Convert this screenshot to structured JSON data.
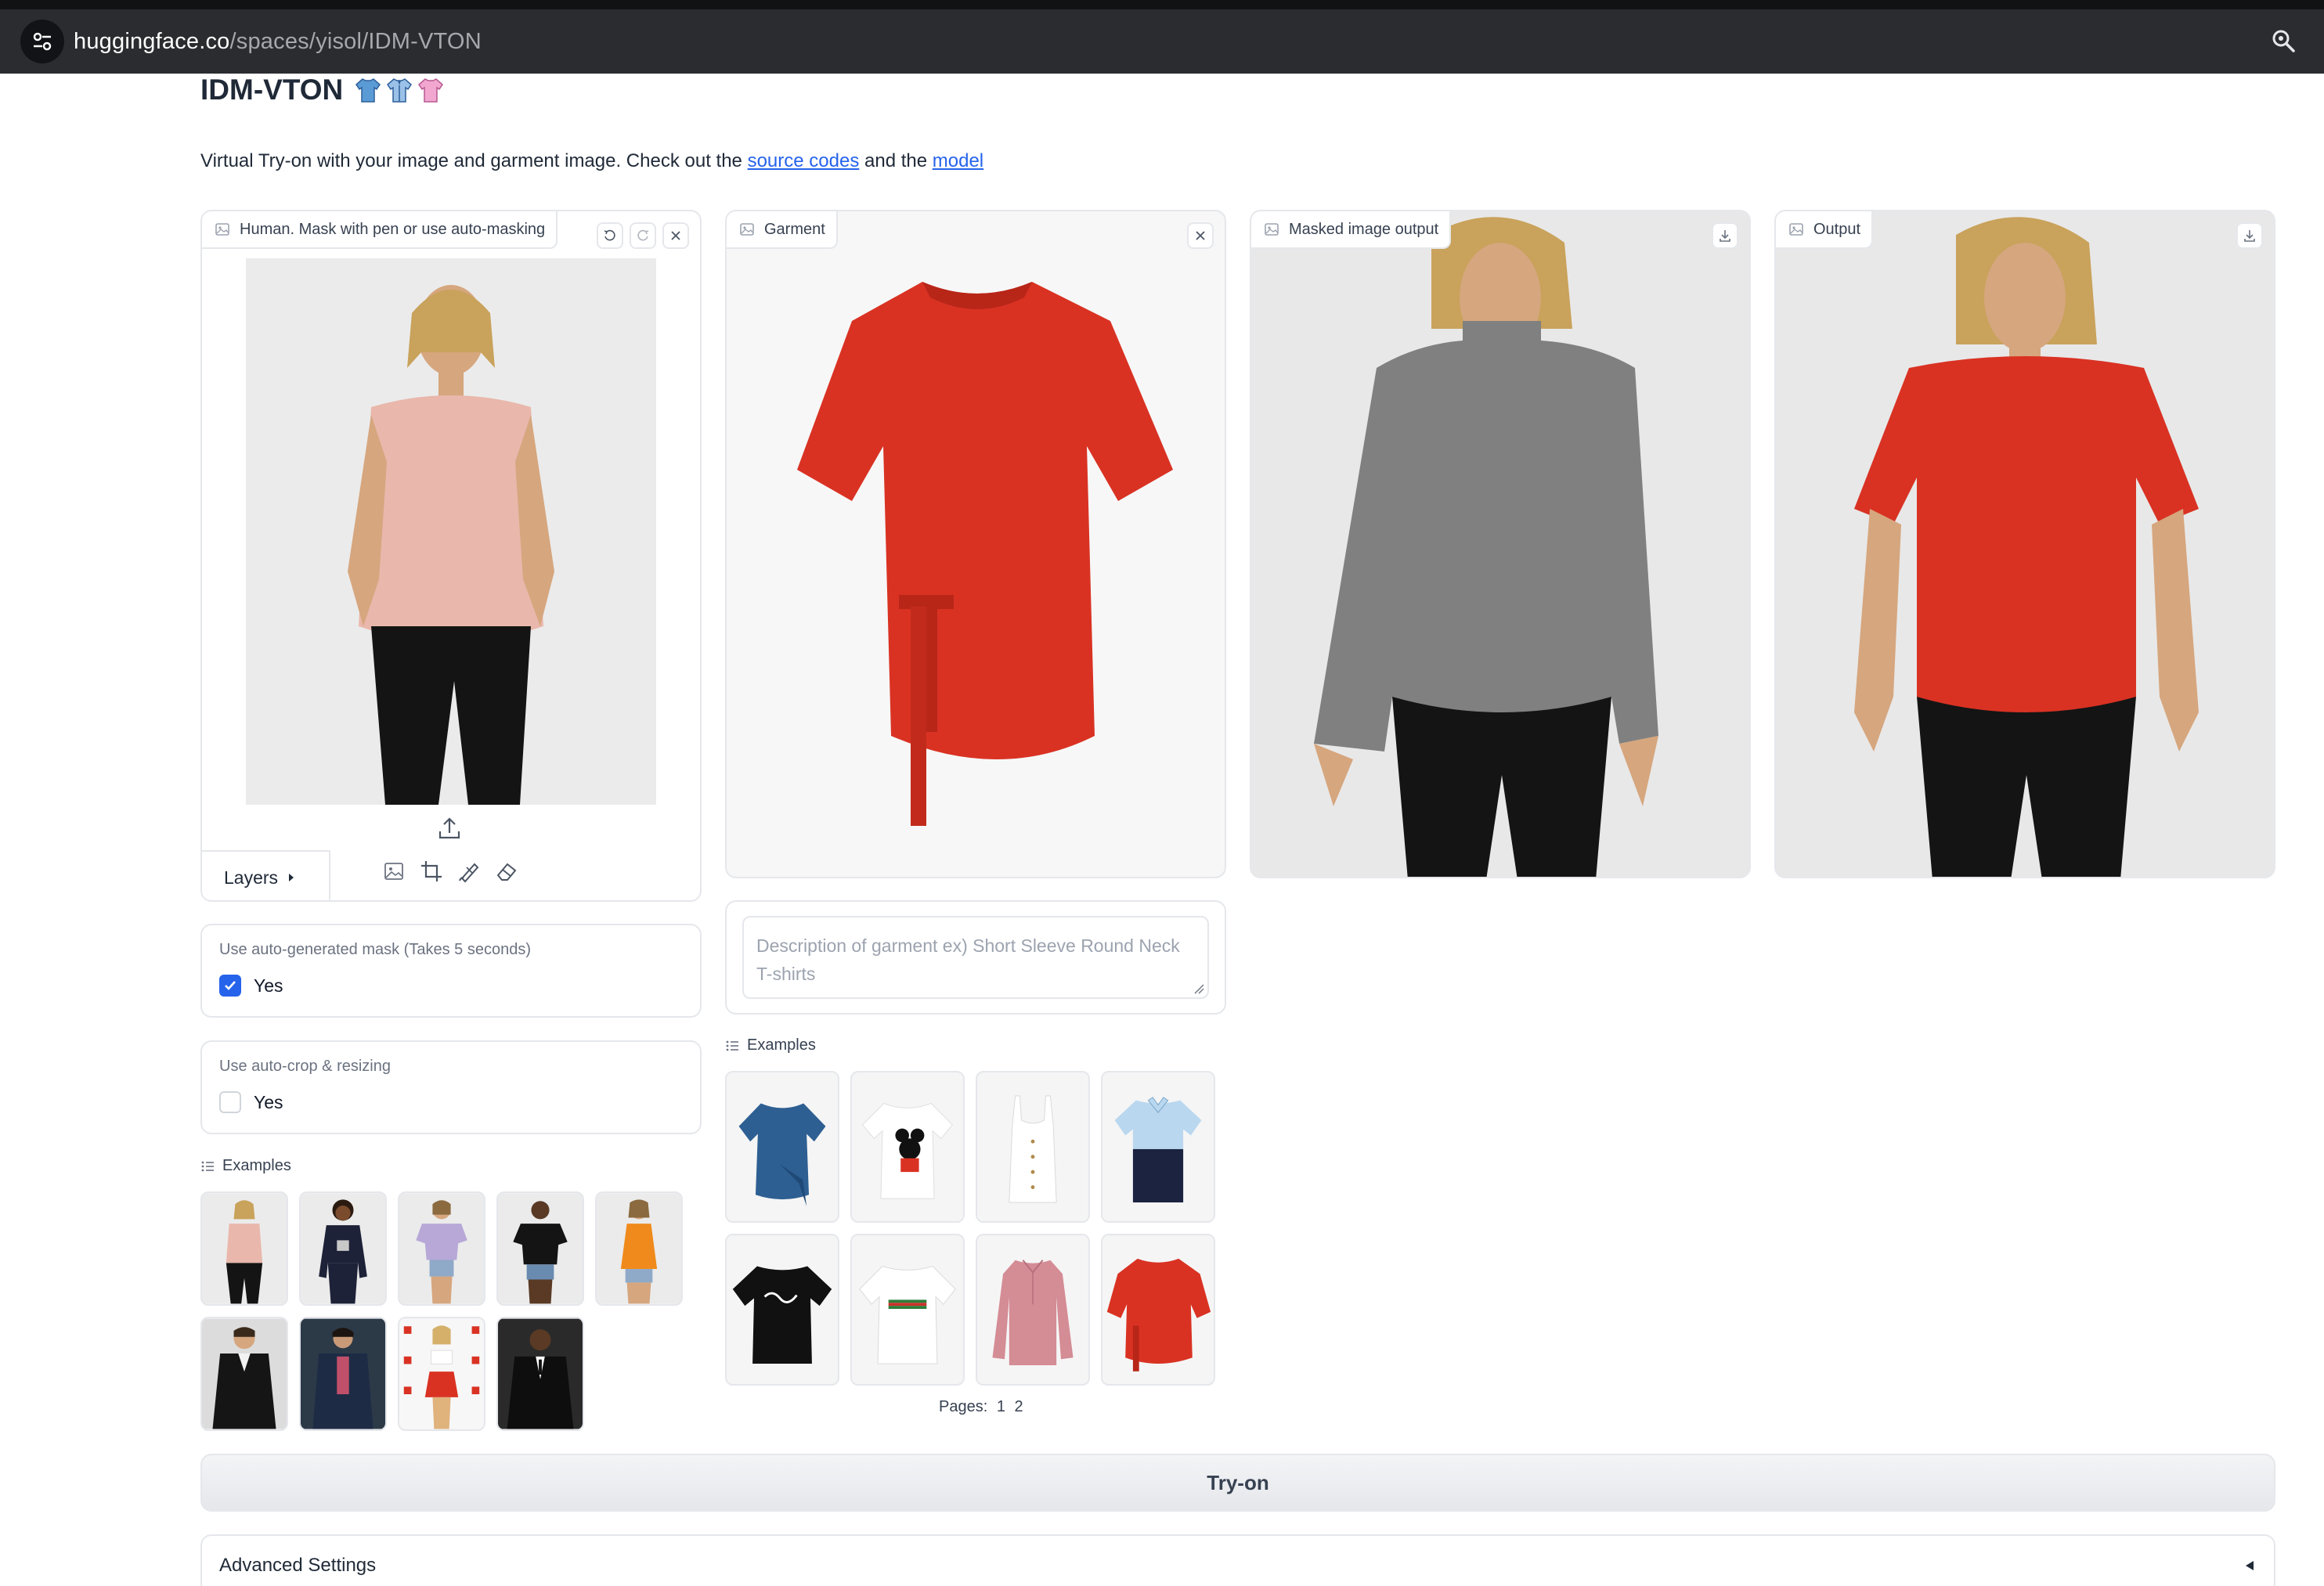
{
  "browser": {
    "url_host": "huggingface.co",
    "url_path": "/spaces/yisol/IDM-VTON"
  },
  "page": {
    "title": "IDM-VTON",
    "description_prefix": "Virtual Try-on with your image and garment image. Check out the ",
    "link_source": "source codes",
    "description_mid": " and the ",
    "link_model": "model"
  },
  "human_panel": {
    "label": "Human. Mask with pen or use auto-masking",
    "layers_label": "Layers"
  },
  "garment_panel": {
    "label": "Garment"
  },
  "masked_panel": {
    "label": "Masked image output"
  },
  "output_panel": {
    "label": "Output"
  },
  "auto_mask": {
    "label": "Use auto-generated mask (Takes 5 seconds)",
    "option": "Yes",
    "checked": true
  },
  "auto_crop": {
    "label": "Use auto-crop & resizing",
    "option": "Yes",
    "checked": false
  },
  "garment_description": {
    "placeholder": "Description of garment ex) Short Sleeve Round Neck T-shirts"
  },
  "human_examples": {
    "label": "Examples",
    "items": [
      "pink sleeveless blouse",
      "navy long sleeve top",
      "lavender t-shirt",
      "black t-shirt",
      "orange tank top",
      "leather jacket",
      "navy blazer",
      "white crop top red skirt",
      "black suit"
    ]
  },
  "garment_examples": {
    "label": "Examples",
    "items": [
      "blue wrap top",
      "minnie mouse tee",
      "white ribbed tank",
      "navy color-block polo",
      "stussy black tee",
      "gucci white tee",
      "pink striped polo",
      "red wrap tee"
    ],
    "pages_label": "Pages:",
    "pages": [
      "1",
      "2"
    ]
  },
  "actions": {
    "tryon_label": "Try-on",
    "advanced_label": "Advanced Settings"
  },
  "colors": {
    "accent": "#2563eb",
    "garment_red": "#d93223",
    "mask_gray": "#808080"
  }
}
